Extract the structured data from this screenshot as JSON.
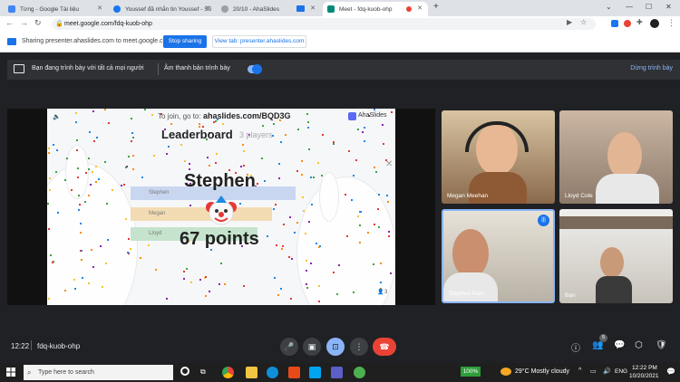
{
  "browser": {
    "tabs": [
      {
        "label": "Từng - Google Tài liệu",
        "color": "#4285f4"
      },
      {
        "label": "Youssef đã nhắn tin Youssef - Số",
        "color": "#1877f2"
      },
      {
        "label": "20/10 - AhaSlides",
        "color": "#9aa0a6"
      },
      {
        "label": "Meet - fdq-kuob-ohp",
        "color": "#00897b"
      }
    ],
    "new_tab": "+",
    "url": "meet.google.com/fdq-kuob-ohp"
  },
  "share_bar": {
    "text": "Sharing presenter.ahaslides.com to meet.google.com",
    "stop_label": "Stop sharing",
    "view_label": "View tab: presenter.ahaslides.com"
  },
  "present_bar": {
    "presenting_text": "Bạn đang trình bày với tất cả mọi người",
    "audio_text": "Âm thanh bản trình bày",
    "stop_label": "Dừng trình bày"
  },
  "presentation": {
    "join_prefix": "To join, go to:",
    "join_url": "ahaslides.com/BQD3G",
    "brand": "AhaSlides",
    "title": "Leaderboard",
    "player_count": "3 players",
    "winner_name": "Stephen",
    "points": "67 points",
    "rows": [
      "Stephen",
      "Megan",
      "Lloyd"
    ],
    "audience_count": "3"
  },
  "participants": [
    {
      "name": "Megan Meehan"
    },
    {
      "name": "Lloyd Cole"
    },
    {
      "name": "Stephen Katri"
    },
    {
      "name": "Bạn"
    }
  ],
  "bottom": {
    "time": "12:22",
    "meeting_code": "fdq-kuob-ohp",
    "people_badge": "5"
  },
  "taskbar": {
    "search_placeholder": "Type here to search",
    "battery": "100%",
    "weather": "29°C  Mostly cloudy",
    "lang": "ENG",
    "clock_time": "12:22 PM",
    "clock_date": "10/20/2021"
  }
}
